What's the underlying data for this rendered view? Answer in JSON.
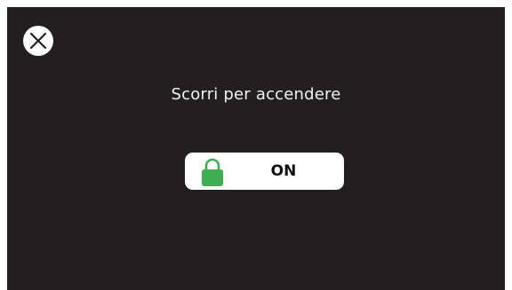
{
  "dialog": {
    "close_icon": "close-icon",
    "title": "Scorri per accendere",
    "slider": {
      "handle_icon": "lock-icon",
      "handle_color": "#3fae50",
      "label": "ON"
    }
  },
  "colors": {
    "background": "#231f20",
    "text": "#f2f2f2",
    "slider_bg": "#ffffff"
  }
}
